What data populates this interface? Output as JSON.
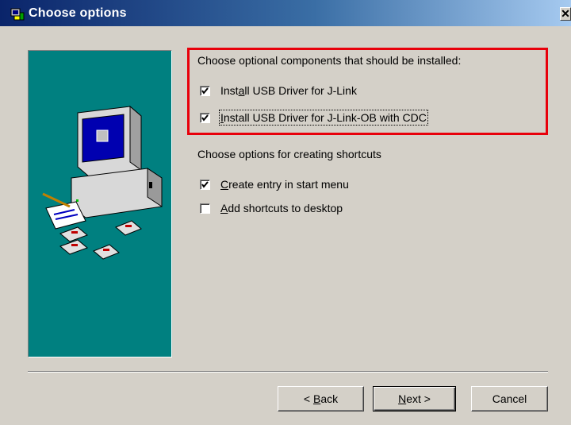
{
  "window": {
    "title": "Choose options",
    "close_label": "✕"
  },
  "components": {
    "heading": "Choose optional components that should be installed:",
    "items": [
      {
        "pre": "Inst",
        "accel": "a",
        "post": "ll USB Driver for J-Link",
        "checked": true
      },
      {
        "pre": "",
        "accel": "I",
        "post": "nstall USB Driver for J-Link-OB with CDC",
        "checked": true
      }
    ]
  },
  "shortcuts": {
    "heading": "Choose options for creating shortcuts",
    "items": [
      {
        "pre": "",
        "accel": "C",
        "post": "reate entry in start menu",
        "checked": true
      },
      {
        "pre": "",
        "accel": "A",
        "post": "dd shortcuts to desktop",
        "checked": false
      }
    ]
  },
  "buttons": {
    "back": {
      "pre": "< ",
      "accel": "B",
      "post": "ack"
    },
    "next": {
      "pre": "",
      "accel": "N",
      "post": "ext >"
    },
    "cancel": "Cancel"
  },
  "colors": {
    "panel": "#008080",
    "highlight": "#e8000b",
    "face": "#d4d0c8"
  }
}
